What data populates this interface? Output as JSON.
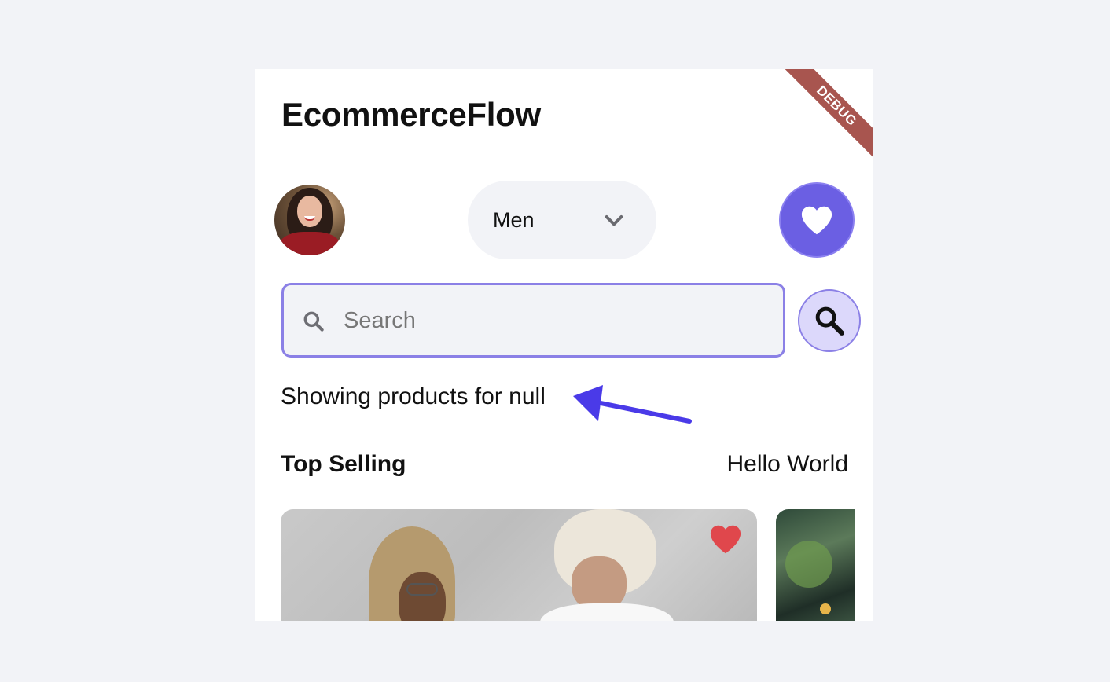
{
  "app": {
    "title": "EcommerceFlow",
    "debug_banner": "DEBUG"
  },
  "header": {
    "gender_selected": "Men",
    "favorites_icon": "heart-icon"
  },
  "search": {
    "placeholder": "Search",
    "value": "",
    "leading_icon": "search-icon",
    "button_icon": "search-icon"
  },
  "results": {
    "showing_text": "Showing products for null"
  },
  "section": {
    "title": "Top Selling",
    "link": "Hello World"
  },
  "colors": {
    "accent": "#6b5fe3",
    "search_border": "#8b80e6",
    "search_button_bg": "#dcd8fb",
    "annotation_arrow": "#4a3ae8",
    "favorite_red": "#e0474c",
    "debug_ribbon": "#a8554f"
  }
}
